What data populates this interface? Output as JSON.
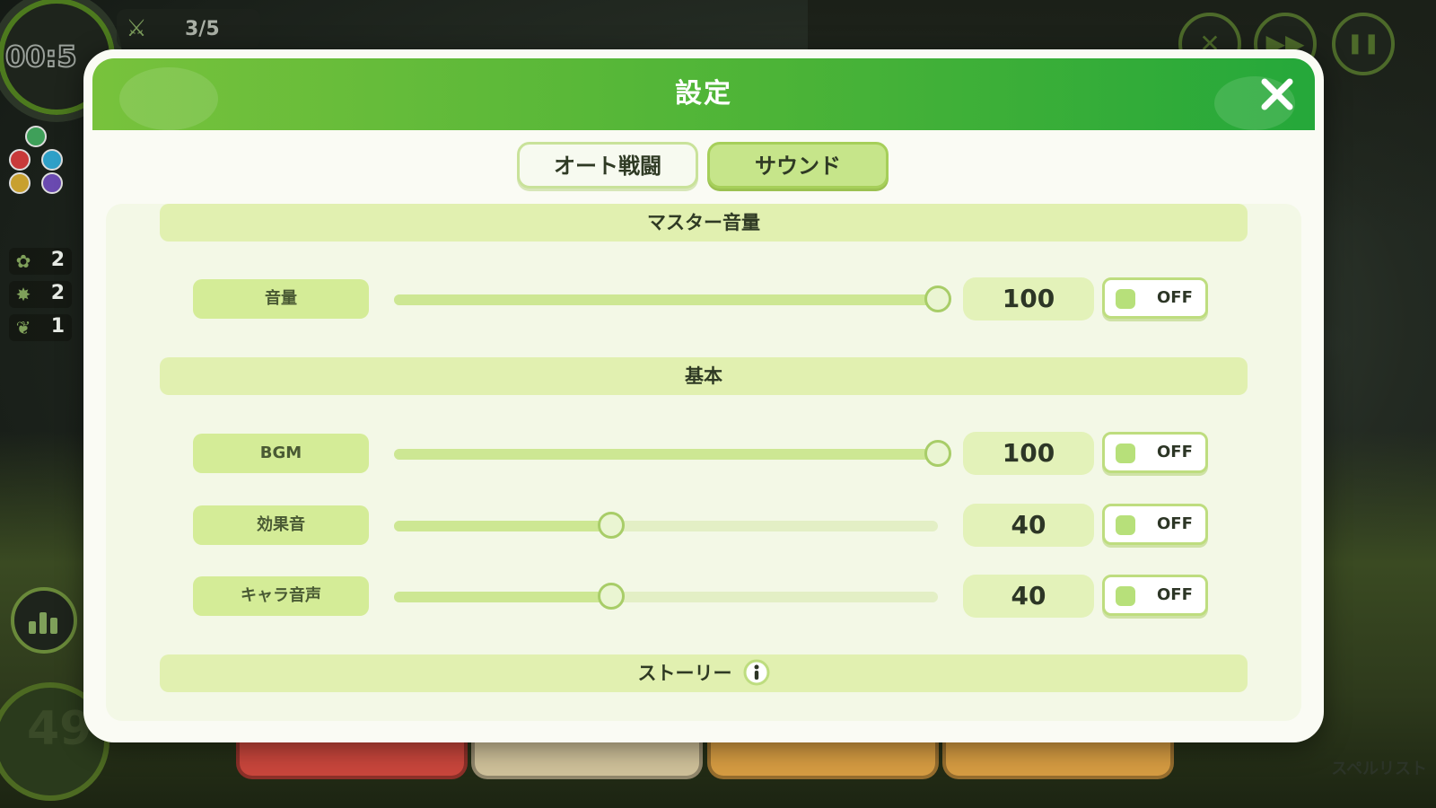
{
  "hud": {
    "timer": "00:5",
    "wave": "3/5",
    "counts": [
      "2",
      "2",
      "1"
    ],
    "mana": "49",
    "spell_list_label": "スペルリスト",
    "bottom_button_colors": [
      "#d9534a",
      "#d8c9a0",
      "#e0a84a",
      "#e0a84a"
    ]
  },
  "dialog": {
    "title": "設定",
    "close_icon": "close-icon",
    "tabs": [
      {
        "label": "オート戦闘",
        "active": false
      },
      {
        "label": "サウンド",
        "active": true
      }
    ],
    "sections": {
      "master": "マスター音量",
      "basic": "基本",
      "story": "ストーリー"
    },
    "rows": [
      {
        "label": "音量",
        "value": "100",
        "level": 1.0,
        "toggle": "OFF"
      },
      {
        "label": "BGM",
        "value": "100",
        "level": 1.0,
        "toggle": "OFF"
      },
      {
        "label": "効果音",
        "value": "40",
        "level": 0.4,
        "toggle": "OFF"
      },
      {
        "label": "キャラ音声",
        "value": "40",
        "level": 0.4,
        "toggle": "OFF"
      }
    ]
  },
  "colors": {
    "header_start": "#78c23c",
    "header_end": "#25a83a",
    "accent_light": "#d4ec97",
    "section_bg": "#e1f0b0"
  }
}
